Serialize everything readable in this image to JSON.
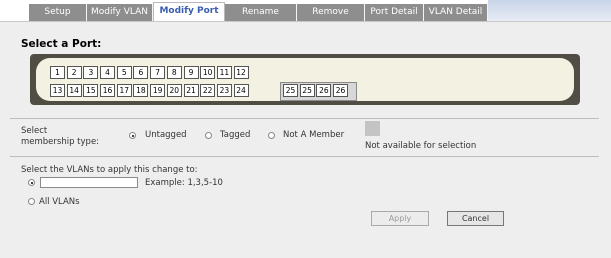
{
  "tabs": [
    {
      "label": "Setup",
      "active": false
    },
    {
      "label": "Modify VLAN",
      "active": false
    },
    {
      "label": "Modify Port",
      "active": true
    },
    {
      "label": "Rename",
      "active": false
    },
    {
      "label": "Remove",
      "active": false
    },
    {
      "label": "Port Detail",
      "active": false
    },
    {
      "label": "VLAN Detail",
      "active": false
    }
  ],
  "title": "Select a Port:",
  "ports_row1": [
    "1",
    "2",
    "3",
    "4",
    "5",
    "6",
    "7",
    "8",
    "9",
    "10",
    "11",
    "12"
  ],
  "ports_row2": [
    "13",
    "14",
    "15",
    "16",
    "17",
    "18",
    "19",
    "20",
    "21",
    "22",
    "23",
    "24"
  ],
  "ports_row2_extra": [
    "25",
    "25",
    "26",
    "26"
  ],
  "membership": {
    "label_line1": "Select",
    "label_line2": "membership type:",
    "options": [
      "Untagged",
      "Tagged",
      "Not A Member"
    ],
    "selected": "Untagged",
    "legend": "Not available for selection"
  },
  "vlans": {
    "label": "Select the VLANs to apply this change to:",
    "input_value": "",
    "example": "Example: 1,3,5-10",
    "all_label": "All VLANs"
  },
  "buttons": {
    "apply": "Apply",
    "cancel": "Cancel"
  },
  "colors": {
    "tab_active_text": "#3a5fb0",
    "panel_frame": "#504d45",
    "panel_fill": "#f3f1e2"
  }
}
